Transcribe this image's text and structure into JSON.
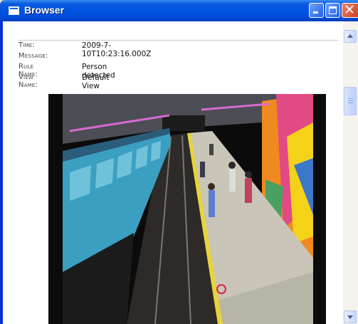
{
  "window": {
    "title": "Browser"
  },
  "event": {
    "time_label": "Time:",
    "time_value": "2009-7-10T10:23:16.000Z",
    "message_label": "Message:",
    "message_value": "",
    "rule_label": "Rule Name:",
    "rule_value": "Person detected",
    "view_label": "View Name:",
    "view_value": "Default View"
  },
  "colors": {
    "titlebar": "#0054e3",
    "train": "#3b9fc2",
    "wall_pink": "#e24a86",
    "wall_orange": "#f08a20",
    "wall_yellow": "#f4d21a"
  },
  "icons": [
    "app-window-icon",
    "minimize-icon",
    "maximize-icon",
    "close-icon",
    "scroll-up-icon",
    "scroll-down-icon"
  ]
}
